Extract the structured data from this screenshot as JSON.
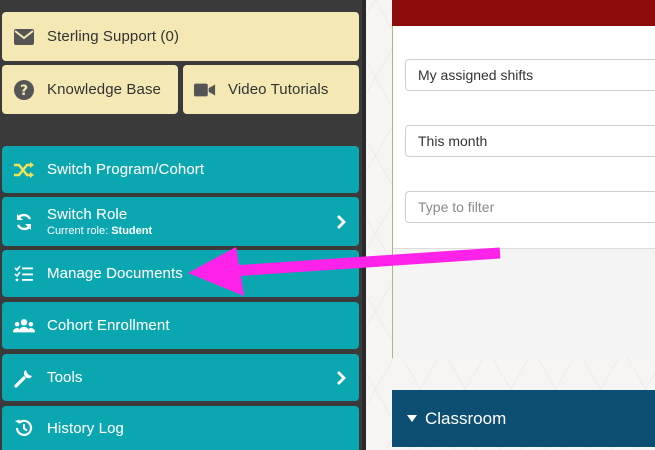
{
  "sidebar": {
    "support_label": "Sterling Support (0)",
    "knowledge_label": "Knowledge Base",
    "video_label": "Video Tutorials",
    "switch_program_label": "Switch Program/Cohort",
    "switch_role_label": "Switch Role",
    "current_role_prefix": "Current role: ",
    "current_role_value": "Student",
    "manage_documents_label": "Manage Documents",
    "cohort_enrollment_label": "Cohort Enrollment",
    "tools_label": "Tools",
    "history_log_label": "History Log"
  },
  "panel": {
    "shift_filter_value": "My assigned shifts",
    "period_filter_value": "This month",
    "filter_placeholder": "Type to filter",
    "classroom_label": "Classroom"
  },
  "colors": {
    "teal": "#0aa7b1",
    "tan": "#f4e8b4",
    "sidebar_bg": "#3a3a3a",
    "header_red": "#8b0a0a",
    "classroom_blue": "#0d4f73",
    "annotation_arrow": "#ff22e8"
  },
  "icons": {
    "support": "envelope-icon",
    "knowledge": "question-circle-icon",
    "video": "video-camera-icon",
    "switch_program": "shuffle-icon",
    "switch_role": "refresh-icon",
    "manage_documents": "checklist-icon",
    "cohort_enrollment": "users-icon",
    "tools": "wrench-icon",
    "history_log": "history-icon"
  }
}
